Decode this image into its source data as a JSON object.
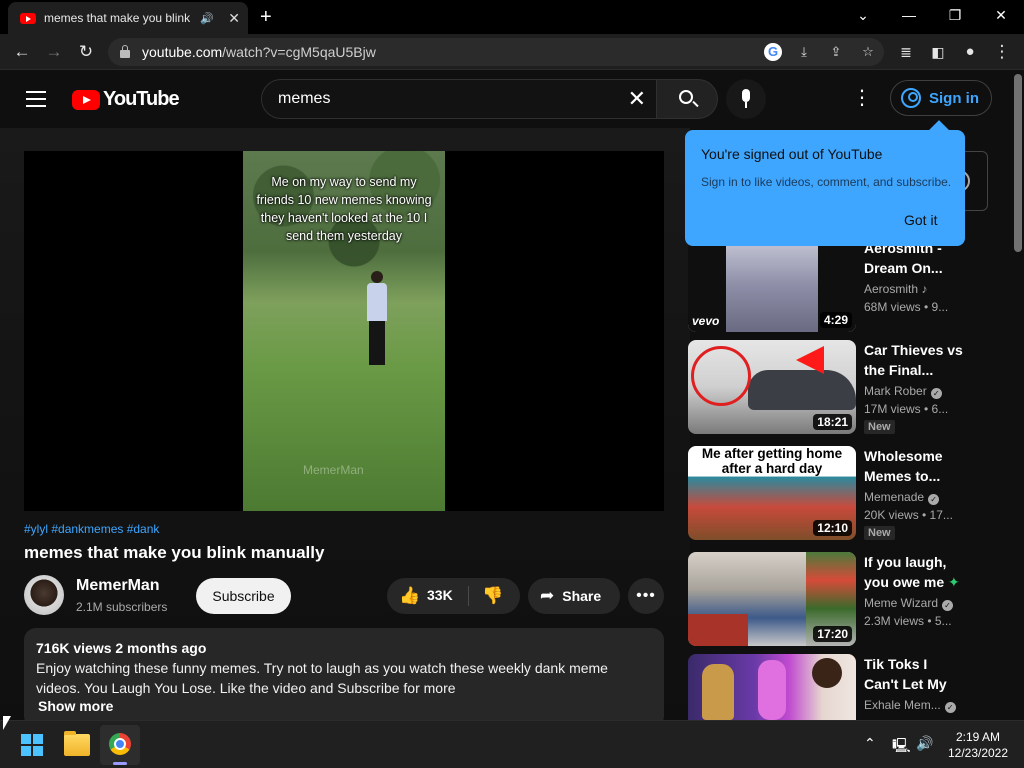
{
  "browser": {
    "tab_title": "memes that make you blink",
    "url_prefix": "youtube.com",
    "url_path": "/watch?v=cgM5qaU5Bjw"
  },
  "header": {
    "logo_text": "YouTube",
    "search_value": "memes",
    "signin_label": "Sign in"
  },
  "video": {
    "caption": "Me on my way to send my friends 10 new memes knowing they haven't looked at the 10 I send them yesterday",
    "watermark": "MemerMan",
    "hashtags": "#ylyl #dankmemes #dank",
    "title": "memes that make you blink manually"
  },
  "channel": {
    "name": "MemerMan",
    "subscribers": "2.1M subscribers",
    "subscribe_label": "Subscribe"
  },
  "actions": {
    "likes": "33K",
    "share_label": "Share"
  },
  "description": {
    "meta": "716K views  2 months ago",
    "text": "Enjoy watching these funny memes. Try not to laugh as you watch these weekly dank meme videos. You Laugh You Lose. Like the video and Subscribe for more",
    "show_more": "Show more"
  },
  "popup": {
    "title": "You're signed out of YouTube",
    "subtitle": "Sign in to like videos, comment, and subscribe.",
    "button": "Got it"
  },
  "sidebar": {
    "items": [
      {
        "title": "Aerosmith - Dream On...",
        "channel": "Aerosmith",
        "views": "68M views • 9...",
        "duration": "4:29",
        "thumb_label": "vevo",
        "new": ""
      },
      {
        "title": "Car Thieves vs the Final...",
        "channel": "Mark Rober",
        "views": "17M views • 6...",
        "duration": "18:21",
        "new": "New"
      },
      {
        "title": "Wholesome Memes to...",
        "channel": "Memenade",
        "views": "20K views • 17...",
        "duration": "12:10",
        "thumb_label": "Me after getting home after a hard day",
        "new": "New"
      },
      {
        "title": "If you laugh, you owe me",
        "channel": "Meme Wizard",
        "views": "2.3M views • 5...",
        "duration": "17:20",
        "new": ""
      },
      {
        "title": "Tik Toks I Can't Let My Family...",
        "channel": "Exhale Mem...",
        "views": "",
        "duration": "",
        "new": ""
      }
    ]
  },
  "taskbar": {
    "time": "2:19 AM",
    "date": "12/23/2022"
  },
  "colors": {
    "accent_blue": "#3ea6ff",
    "youtube_red": "#ff0000",
    "background": "#0f0f0f"
  }
}
